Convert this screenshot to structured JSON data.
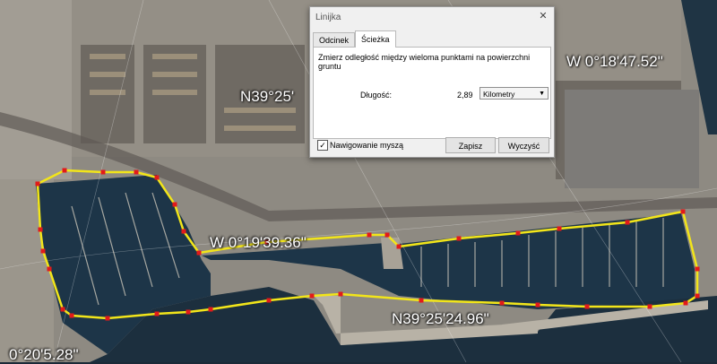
{
  "map": {
    "coord_labels": {
      "top_center": "N39°25'",
      "top_right": "W 0°18'47.52\"",
      "middle_left": "W 0°19'39.36\"",
      "bottom_center": "N39°25'24.96\"",
      "bottom_left": "0°20'5.28\""
    },
    "path_color": "#f2e51a",
    "point_color": "#e21a1a"
  },
  "dialog": {
    "title": "Linijka",
    "close_icon": "close-icon",
    "tabs": [
      {
        "label": "Odcinek",
        "active": false
      },
      {
        "label": "Ścieżka",
        "active": true
      }
    ],
    "description": "Zmierz odległość między wieloma punktami na powierzchni gruntu",
    "length_label": "Długość:",
    "length_value": "2,89",
    "unit": "Kilometry",
    "mouse_nav_label": "Nawigowanie myszą",
    "mouse_nav_checked": true,
    "save_label": "Zapisz",
    "clear_label": "Wyczyść"
  }
}
